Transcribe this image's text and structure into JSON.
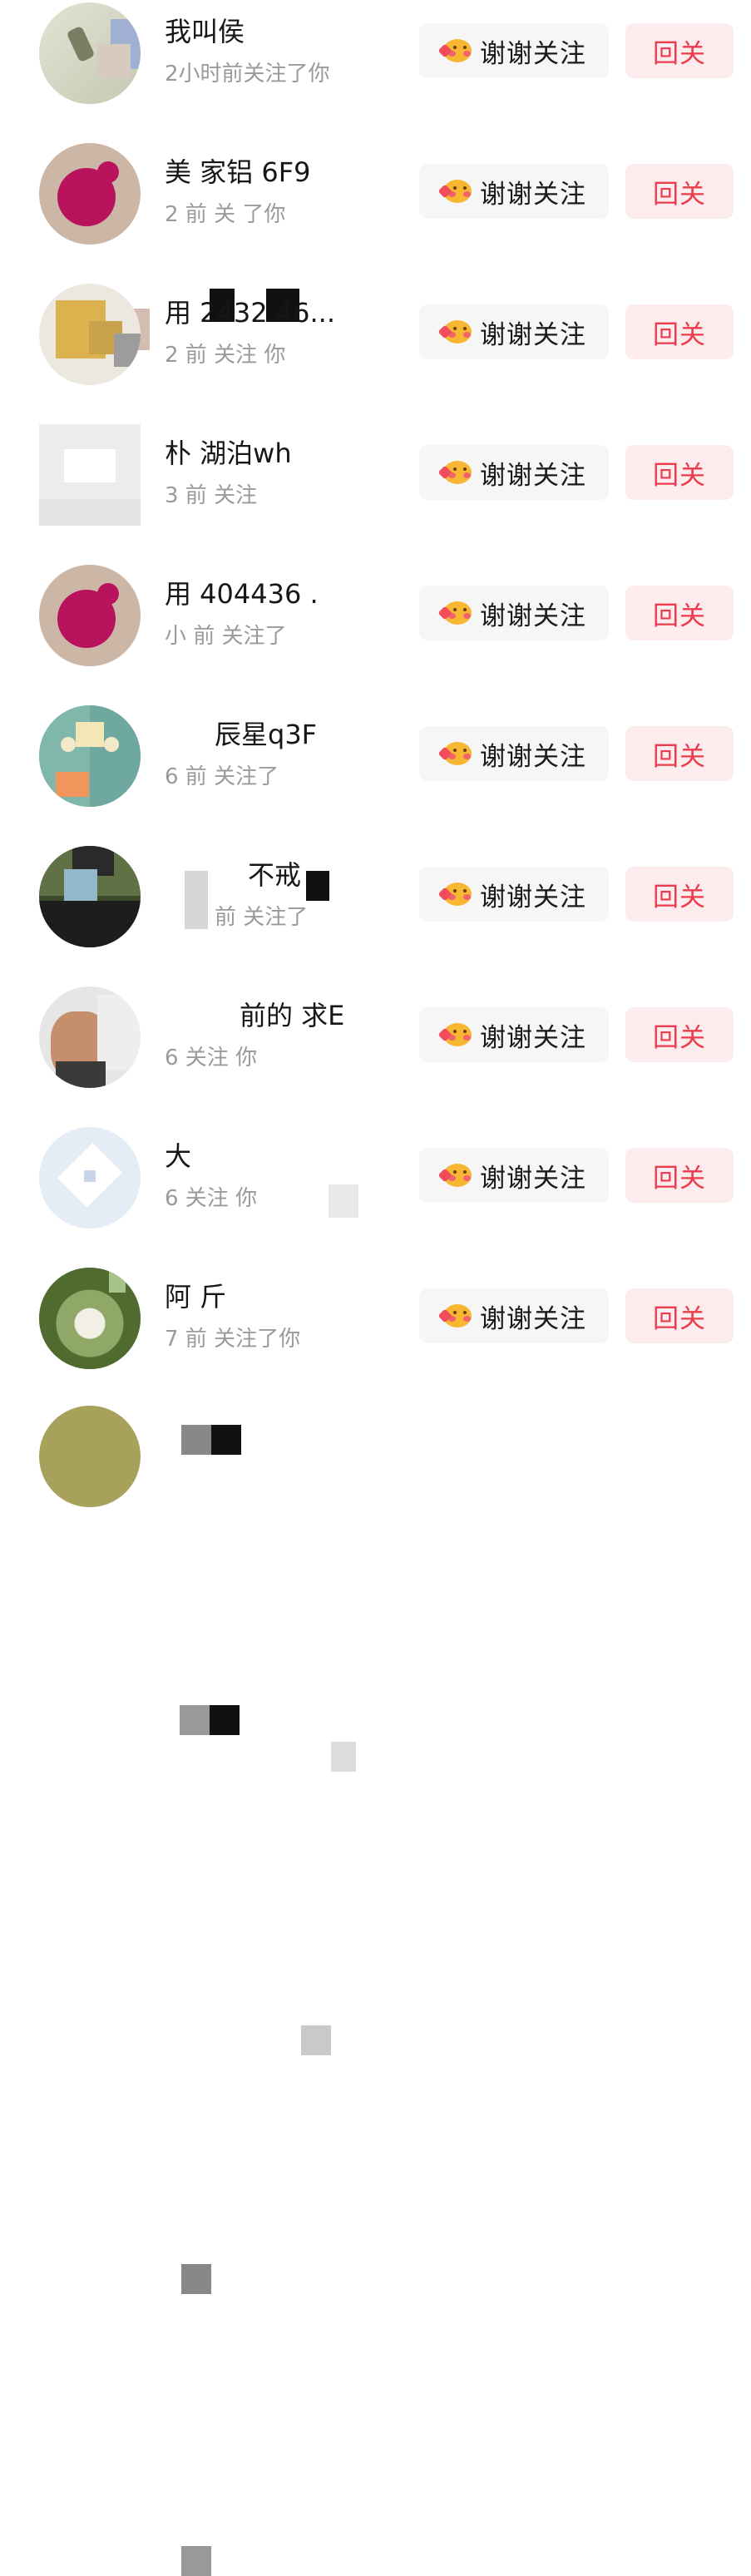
{
  "followers": [
    {
      "name": "我叫侯",
      "meta": "2小时前关注了你",
      "thanks_label": "谢谢关注",
      "follow_label": "回关",
      "avatar_icon": "calligraphy-avatar"
    },
    {
      "name": "美 家铝 6F9",
      "meta": "2 前 关 了你",
      "thanks_label": "谢谢关注",
      "follow_label": "回关",
      "avatar_icon": "pink-pig-avatar"
    },
    {
      "name": "用 2432 46...",
      "meta": "2 前 关注 你",
      "thanks_label": "谢谢关注",
      "follow_label": "回关",
      "avatar_icon": "gold-blur-avatar"
    },
    {
      "name": "朴 湖泊wh",
      "meta": "3 前 关注",
      "thanks_label": "谢谢关注",
      "follow_label": "回关",
      "avatar_icon": "gray-blur-avatar"
    },
    {
      "name": "用 404436 .",
      "meta": "小 前 关注了",
      "thanks_label": "谢谢关注",
      "follow_label": "回关",
      "avatar_icon": "pink-pig-avatar"
    },
    {
      "name": "辰星q3F",
      "meta": "6 前 关注了",
      "thanks_label": "谢谢关注",
      "follow_label": "回关",
      "avatar_icon": "cartoon-face-avatar"
    },
    {
      "name": "不戒",
      "meta": "前 关注了",
      "thanks_label": "谢谢关注",
      "follow_label": "回关",
      "avatar_icon": "person-photo-avatar"
    },
    {
      "name": "前的 求E",
      "meta": "6 关注 你",
      "thanks_label": "谢谢关注",
      "follow_label": "回关",
      "avatar_icon": "man-photo-avatar"
    },
    {
      "name": "大",
      "meta": "6 关注 你",
      "thanks_label": "谢谢关注",
      "follow_label": "回关",
      "avatar_icon": "star-logo-avatar"
    },
    {
      "name": "阿 斤",
      "meta": "7 前 关注了你",
      "thanks_label": "谢谢关注",
      "follow_label": "回关",
      "avatar_icon": "flower-photo-avatar"
    }
  ],
  "colors": {
    "accent": "#ec3b4a",
    "follow_bg": "#fdeced",
    "thanks_bg": "#f6f6f6",
    "meta_text": "#9a9a9a"
  }
}
